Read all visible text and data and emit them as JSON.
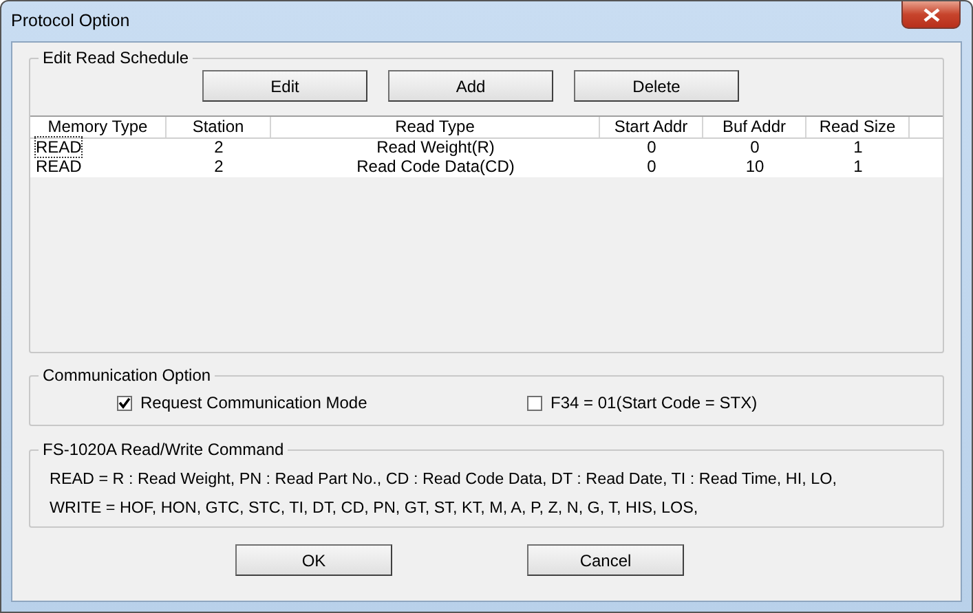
{
  "window": {
    "title": "Protocol Option"
  },
  "schedule": {
    "title": "Edit Read Schedule",
    "buttons": [
      "Edit",
      "Add",
      "Delete"
    ],
    "columns": [
      "Memory Type",
      "Station",
      "Read Type",
      "Start Addr",
      "Buf Addr",
      "Read Size"
    ],
    "rows": [
      {
        "cells": [
          "READ",
          "2",
          "Read Weight(R)",
          "0",
          "0",
          "1"
        ],
        "focused": true
      },
      {
        "cells": [
          "READ",
          "2",
          "Read Code Data(CD)",
          "0",
          "10",
          "1"
        ],
        "focused": false
      }
    ]
  },
  "communication": {
    "title": "Communication Option",
    "options": [
      {
        "label": "Request Communication Mode",
        "checked": true
      },
      {
        "label": "F34 = 01(Start Code = STX)",
        "checked": false
      }
    ]
  },
  "commands": {
    "title": "FS-1020A Read/Write Command",
    "lines": [
      "READ = R : Read Weight, PN : Read Part No., CD : Read Code Data, DT : Read Date, TI : Read Time,  HI,  LO,",
      "WRITE = HOF, HON, GTC, STC, TI, DT, CD, PN, GT, ST, KT, M, A, P, Z, N, G, T, HIS, LOS,"
    ]
  },
  "buttons": [
    "OK",
    "Cancel"
  ]
}
